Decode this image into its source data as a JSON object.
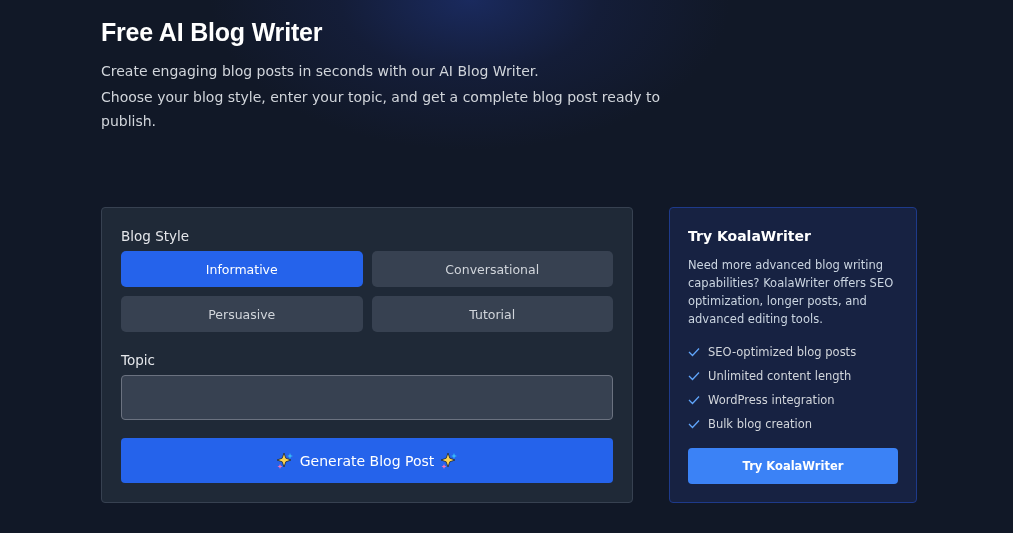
{
  "header": {
    "title": "Free AI Blog Writer",
    "paragraphs": [
      "Create engaging blog posts in seconds with our AI Blog Writer.",
      "Choose your blog style, enter your topic, and get a complete blog post ready to publish."
    ]
  },
  "form": {
    "style_label": "Blog Style",
    "styles": [
      {
        "label": "Informative",
        "selected": true
      },
      {
        "label": "Conversational",
        "selected": false
      },
      {
        "label": "Persuasive",
        "selected": false
      },
      {
        "label": "Tutorial",
        "selected": false
      }
    ],
    "topic_label": "Topic",
    "generate_button": "Generate Blog Post"
  },
  "promo": {
    "title": "Try KoalaWriter",
    "text": "Need more advanced blog writing capabilities? KoalaWriter offers SEO optimization, longer posts, and advanced editing tools.",
    "features": [
      "SEO-optimized blog posts",
      "Unlimited content length",
      "WordPress integration",
      "Bulk blog creation"
    ],
    "button": "Try KoalaWriter"
  }
}
